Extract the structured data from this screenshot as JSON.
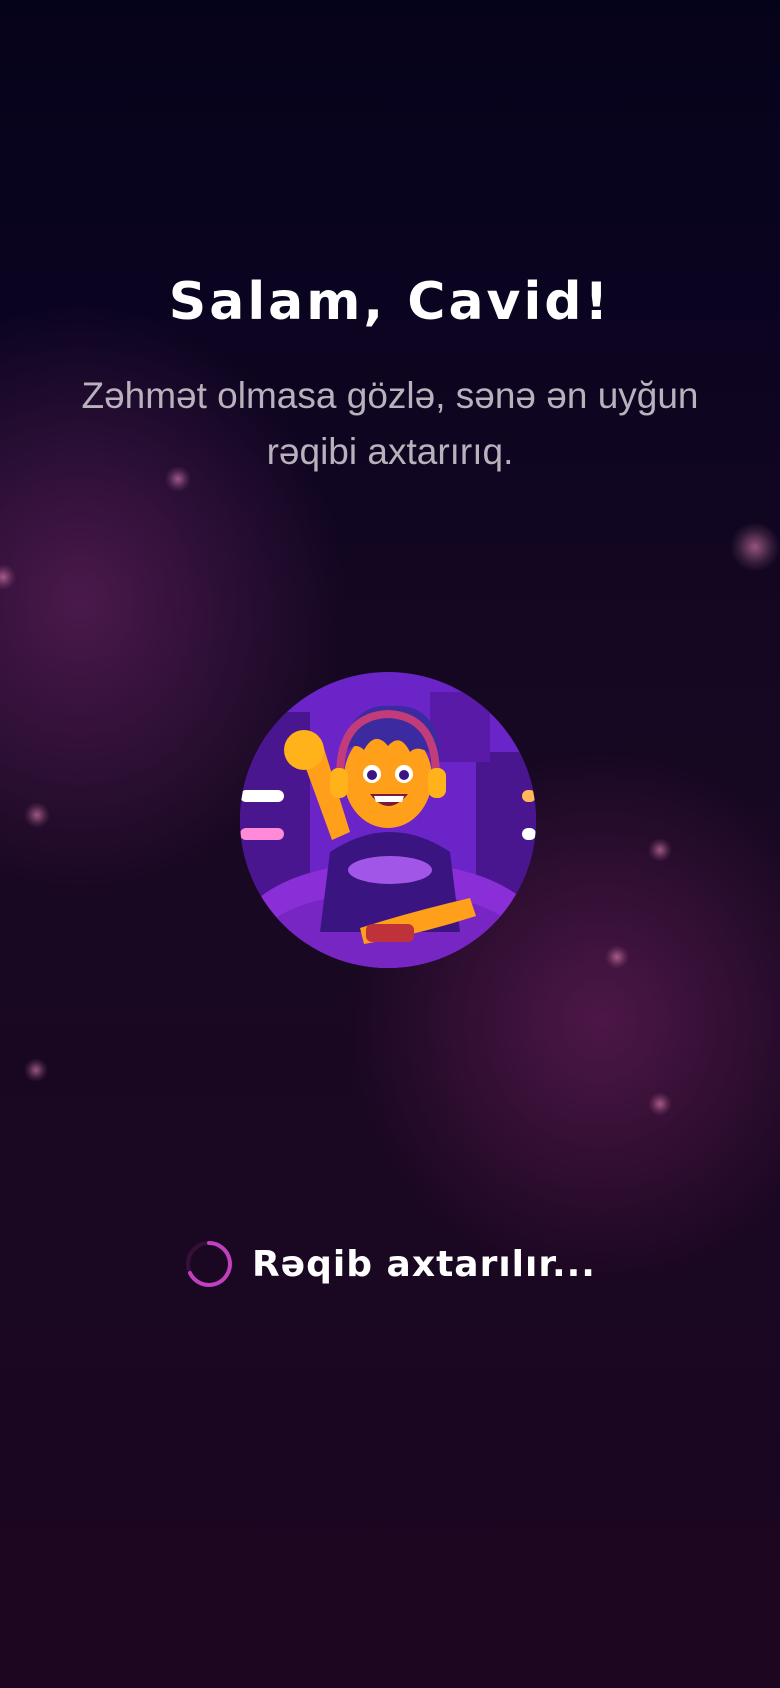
{
  "screen": {
    "title": "Salam, Cavid!",
    "subtitle": "Zəhmət olmasa gözlə, sənə ən uyğun rəqibi axtarırıq.",
    "avatar_icon": "gamer-avatar-icon",
    "loading_text": "Rəqib axtarılır...",
    "spinner_icon": "loading-spinner-icon"
  },
  "colors": {
    "background_top": "#05031a",
    "background_bottom": "#1c0620",
    "accent": "#c040c0",
    "avatar_bg": "#6b24c8",
    "character_skin": "#ff9f1a"
  }
}
